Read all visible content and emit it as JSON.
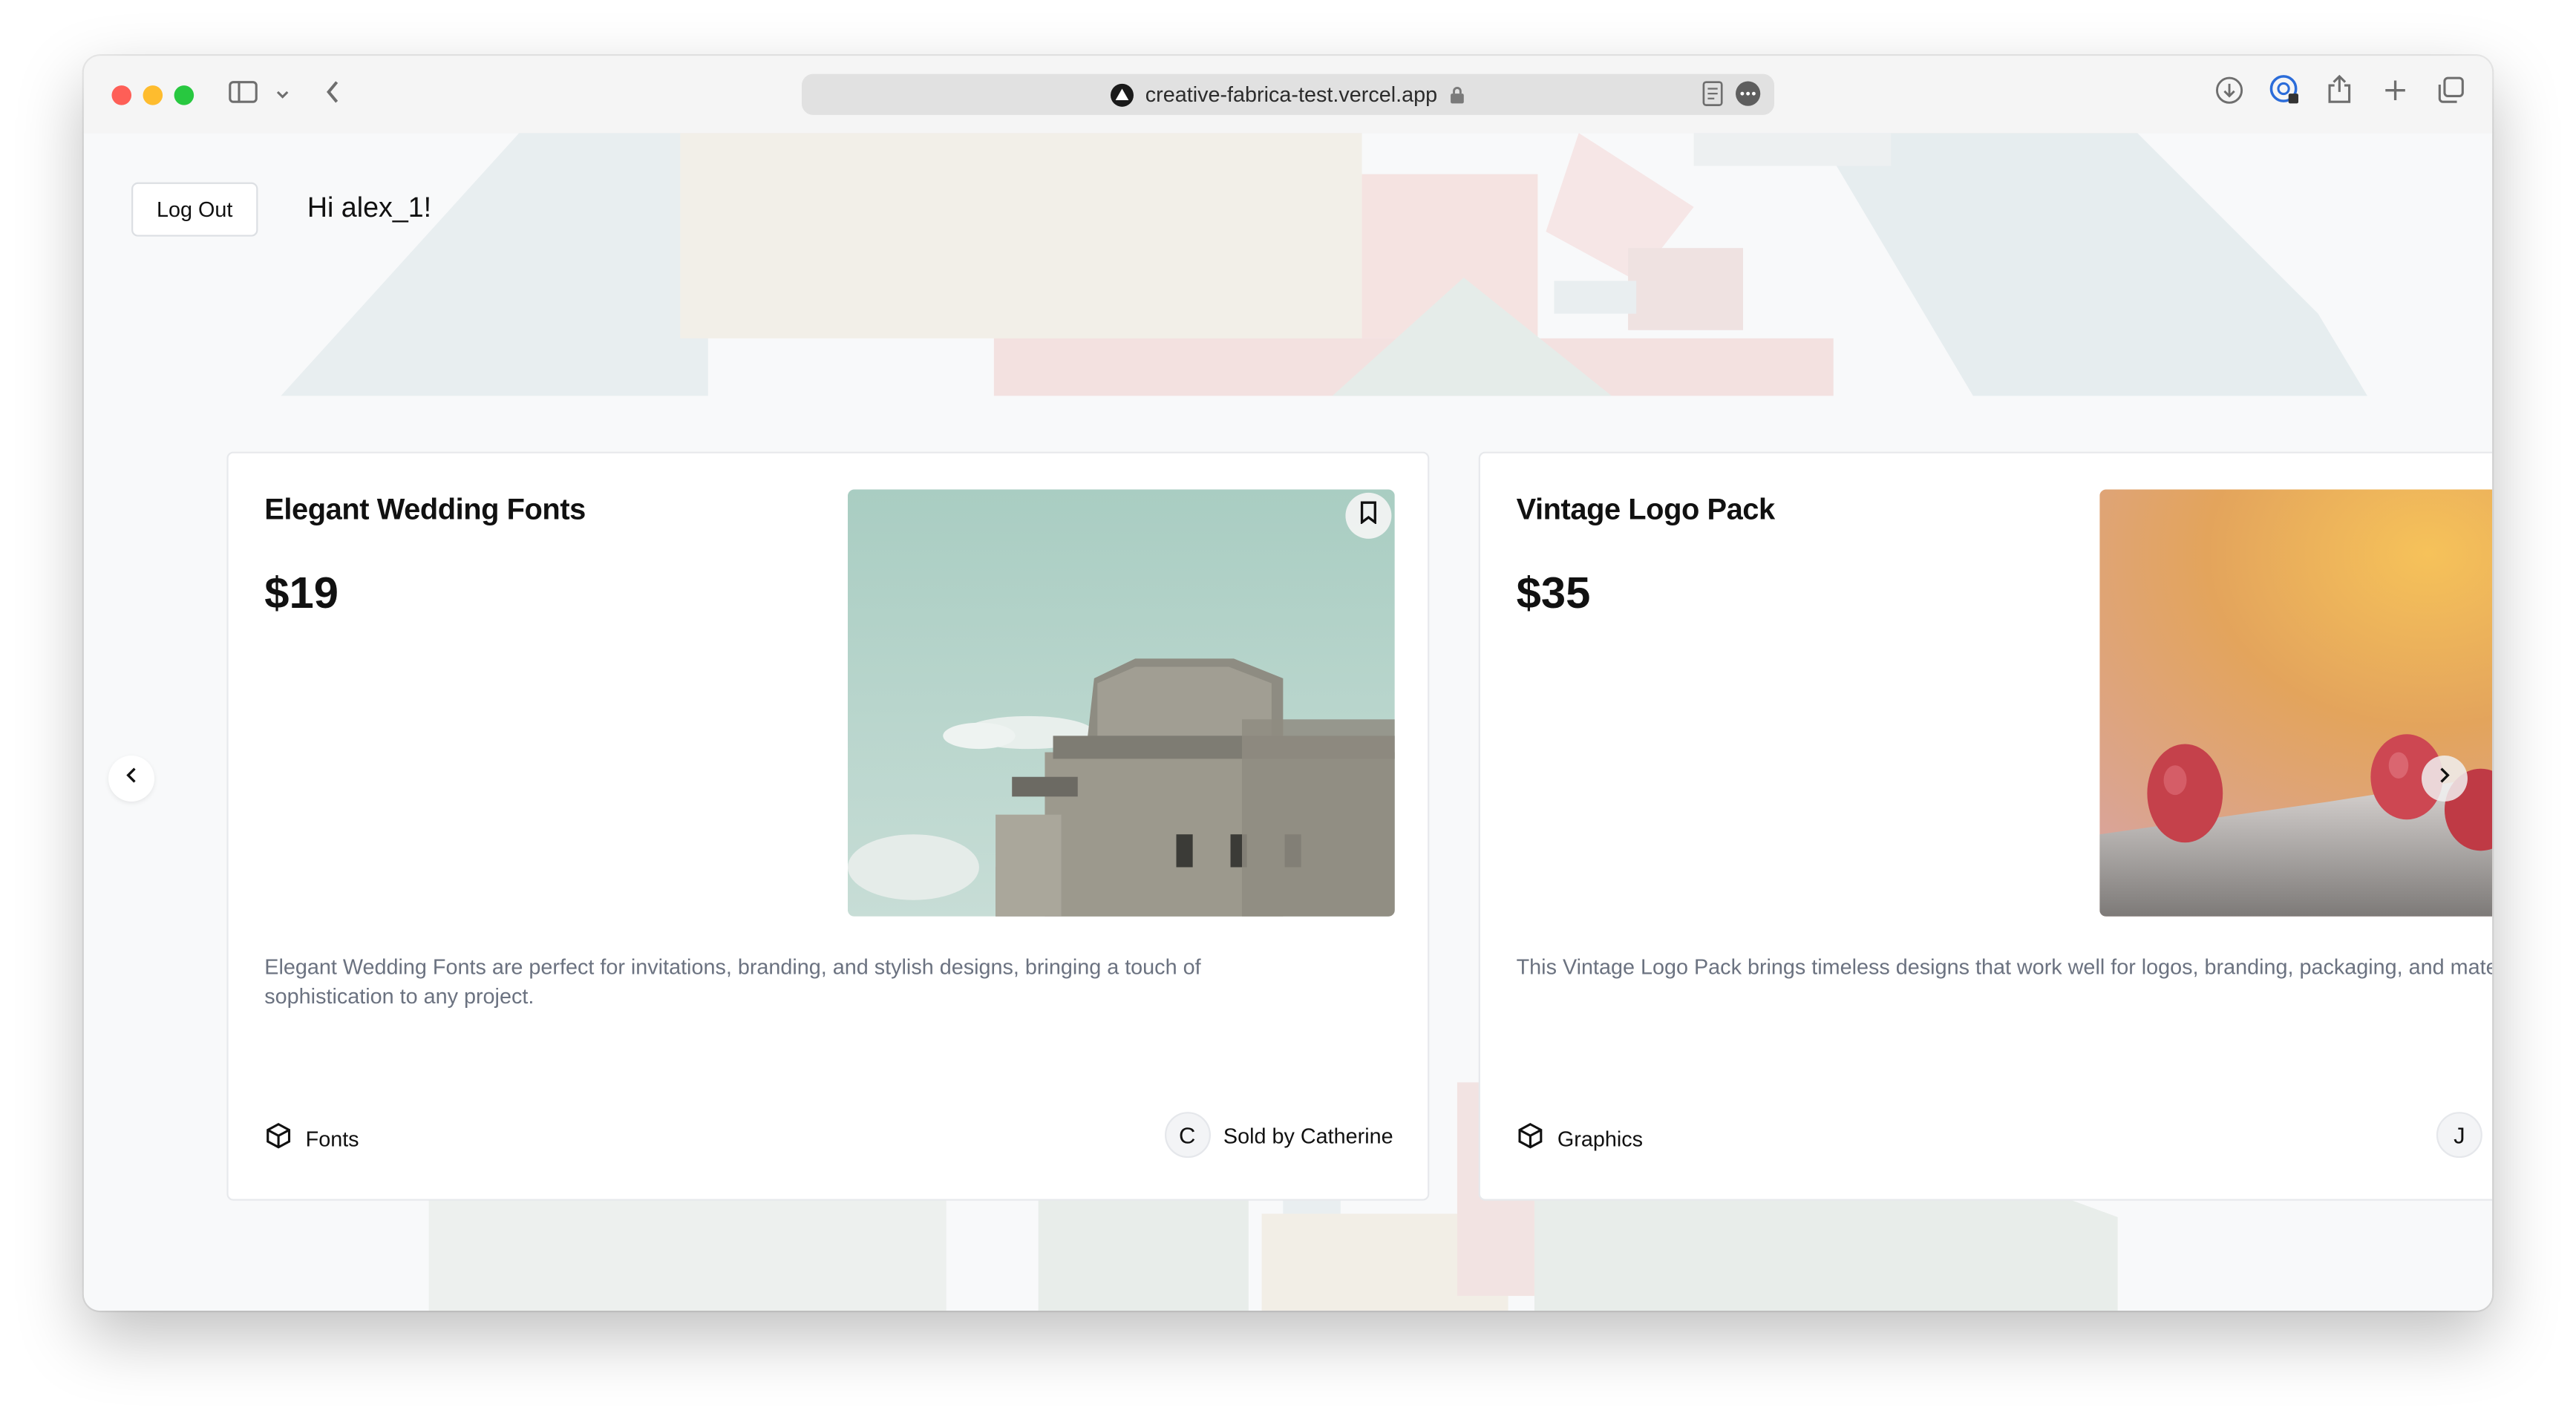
{
  "browser": {
    "url": "creative-fabrica-test.vercel.app"
  },
  "header": {
    "logout_label": "Log Out",
    "greeting": "Hi alex_1!"
  },
  "products": [
    {
      "title": "Elegant Wedding Fonts",
      "price": "$19",
      "description": "Elegant Wedding Fonts are perfect for invitations, branding, and stylish designs, bringing a touch of sophistication to any project.",
      "category": "Fonts",
      "seller_initial": "C",
      "seller_label": "Sold by Catherine"
    },
    {
      "title": "Vintage Logo Pack",
      "price": "$35",
      "description": "This Vintage Logo Pack brings timeless designs that work well for logos, branding, packaging, and materials.",
      "category": "Graphics",
      "seller_initial": "J",
      "seller_label": ""
    }
  ],
  "colors": {
    "window_bg": "#f8f9fa",
    "card_bg": "#ffffff",
    "text_primary": "#111111",
    "text_muted": "#6b7280",
    "traffic_red": "#fe5f57",
    "traffic_yellow": "#febc2e",
    "traffic_green": "#28c840"
  },
  "icons": {
    "sidebar": "sidebar-icon",
    "back": "chevron-left-icon",
    "downloads": "download-icon",
    "share": "share-icon",
    "new_tab": "plus-icon",
    "tabs": "tabs-icon",
    "bookmark": "bookmark-icon",
    "category": "box-icon"
  }
}
